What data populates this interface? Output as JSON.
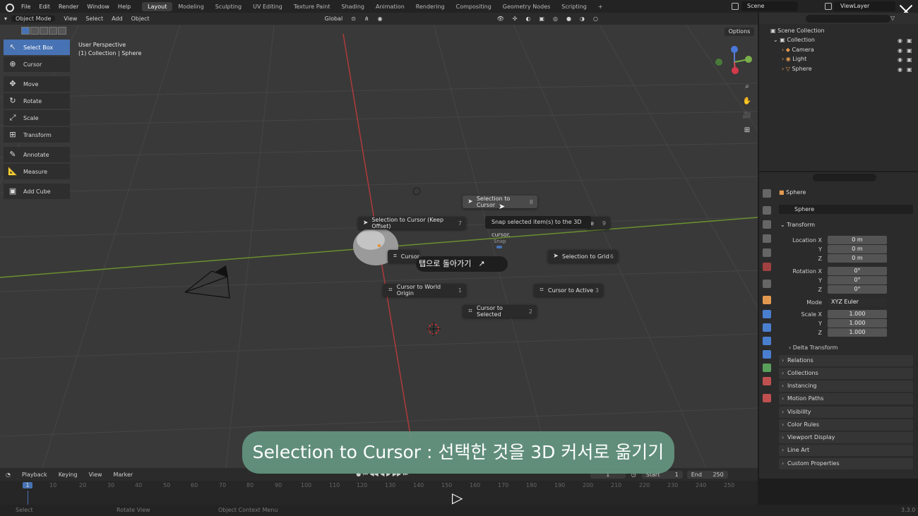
{
  "topbar": {
    "menus": [
      "File",
      "Edit",
      "Render",
      "Window",
      "Help"
    ],
    "workspaces": [
      "Layout",
      "Modeling",
      "Sculpting",
      "UV Editing",
      "Texture Paint",
      "Shading",
      "Animation",
      "Rendering",
      "Compositing",
      "Geometry Nodes",
      "Scripting"
    ],
    "add_tab": "+",
    "scene": "Scene",
    "view_layer": "ViewLayer"
  },
  "viewport": {
    "mode": "Object Mode",
    "menus": [
      "View",
      "Select",
      "Add",
      "Object"
    ],
    "orientation": "Global",
    "options": "Options",
    "info_line1": "User Perspective",
    "info_line2": "(1) Collection | Sphere"
  },
  "toolbar": {
    "tools": [
      {
        "label": "Select Box",
        "icon": "↖"
      },
      {
        "label": "Cursor",
        "icon": "⊕"
      },
      {
        "label": "Move",
        "icon": "✥"
      },
      {
        "label": "Rotate",
        "icon": "↻"
      },
      {
        "label": "Scale",
        "icon": "⤢"
      },
      {
        "label": "Transform",
        "icon": "⊞"
      },
      {
        "label": "Annotate",
        "icon": "✎"
      },
      {
        "label": "Measure",
        "icon": "📐"
      },
      {
        "label": "Add Cube",
        "icon": "▣"
      }
    ]
  },
  "pie": {
    "title": "Snap",
    "items": [
      {
        "label": "Selection to Cursor",
        "key": "8"
      },
      {
        "label": "Selection to Cursor (Keep Offset)",
        "key": "7"
      },
      {
        "label": "Cursor",
        "key": ""
      },
      {
        "label": "Selection to Grid",
        "key": "6"
      },
      {
        "label": "Cursor to World Origin",
        "key": "1"
      },
      {
        "label": "Cursor to Active",
        "key": "3"
      },
      {
        "label": "Cursor to Selected",
        "key": "2"
      }
    ],
    "partial_key": "9",
    "partial_char": "e",
    "tooltip": "Snap selected item(s) to the 3D cursor."
  },
  "overlay_tab": "탭으로 돌아가기",
  "outliner": {
    "root": "Scene Collection",
    "collection": "Collection",
    "items": [
      "Camera",
      "Light",
      "Sphere"
    ]
  },
  "properties": {
    "object_name": "Sphere",
    "data_name": "Sphere",
    "transform_title": "Transform",
    "location": {
      "label": "Location X",
      "y": "Y",
      "z": "Z",
      "vals": [
        "0 m",
        "0 m",
        "0 m"
      ]
    },
    "rotation": {
      "label": "Rotation X",
      "y": "Y",
      "z": "Z",
      "vals": [
        "0°",
        "0°",
        "0°"
      ]
    },
    "mode_label": "Mode",
    "mode": "XYZ Euler",
    "scale": {
      "label": "Scale X",
      "y": "Y",
      "z": "Z",
      "vals": [
        "1.000",
        "1.000",
        "1.000"
      ]
    },
    "delta": "Delta Transform",
    "sections": [
      "Relations",
      "Collections",
      "Instancing",
      "Motion Paths",
      "Visibility",
      "Color Rules",
      "Viewport Display",
      "Line Art",
      "Custom Properties"
    ]
  },
  "timeline": {
    "menus": [
      "Playback",
      "Keying",
      "View",
      "Marker"
    ],
    "current": "1",
    "start_label": "Start",
    "start": "1",
    "end_label": "End",
    "end": "250",
    "ruler": [
      "1",
      "10",
      "20",
      "30",
      "40",
      "50",
      "60",
      "70",
      "80",
      "90",
      "100",
      "110",
      "120",
      "130",
      "140",
      "150",
      "160",
      "170",
      "180",
      "190",
      "200",
      "210",
      "220",
      "230",
      "240",
      "250"
    ]
  },
  "status": {
    "select": "Select",
    "rotate": "Rotate View",
    "context": "Object Context Menu",
    "version": "3.3.0"
  },
  "caption": "Selection to Cursor : 선택한 것을 3D 커서로 옮기기",
  "colors": {
    "accent": "#4772b3",
    "caption_bg": "#64967f"
  }
}
